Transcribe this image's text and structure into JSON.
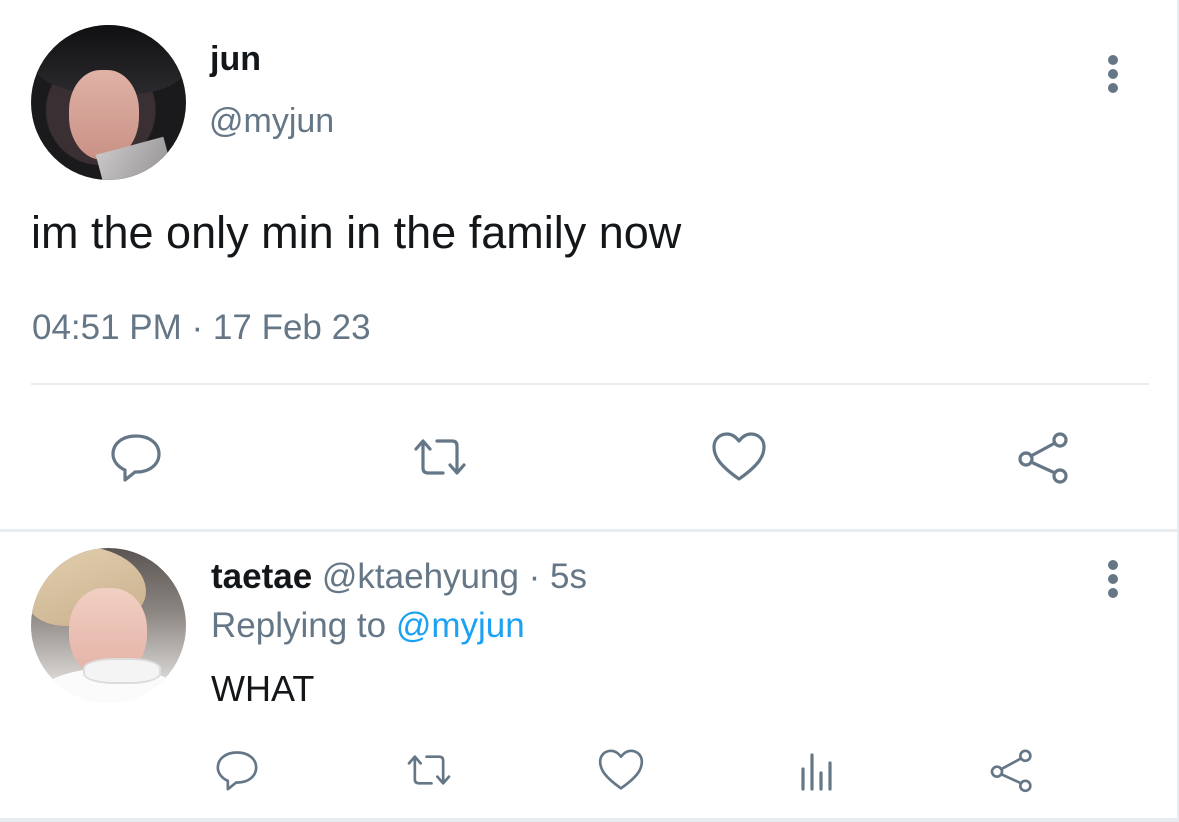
{
  "tweet": {
    "author_name": "jun",
    "author_handle": "@myjun",
    "text": "im the only min in the family now",
    "timestamp": "04:51 PM · 17 Feb 23",
    "actions": [
      "reply-icon",
      "retweet-icon",
      "like-icon",
      "share-icon"
    ]
  },
  "reply": {
    "author_name": "taetae",
    "meta": "@ktaehyung · 5s",
    "replying_prefix": "Replying to ",
    "replying_handle": "@myjun",
    "text": "WHAT",
    "actions": [
      "reply-icon",
      "retweet-icon",
      "like-icon",
      "analytics-icon",
      "share-icon"
    ]
  },
  "colors": {
    "text": "#14171a",
    "secondary": "#657786",
    "link": "#1da1f2",
    "divider": "#e6ecf0"
  }
}
